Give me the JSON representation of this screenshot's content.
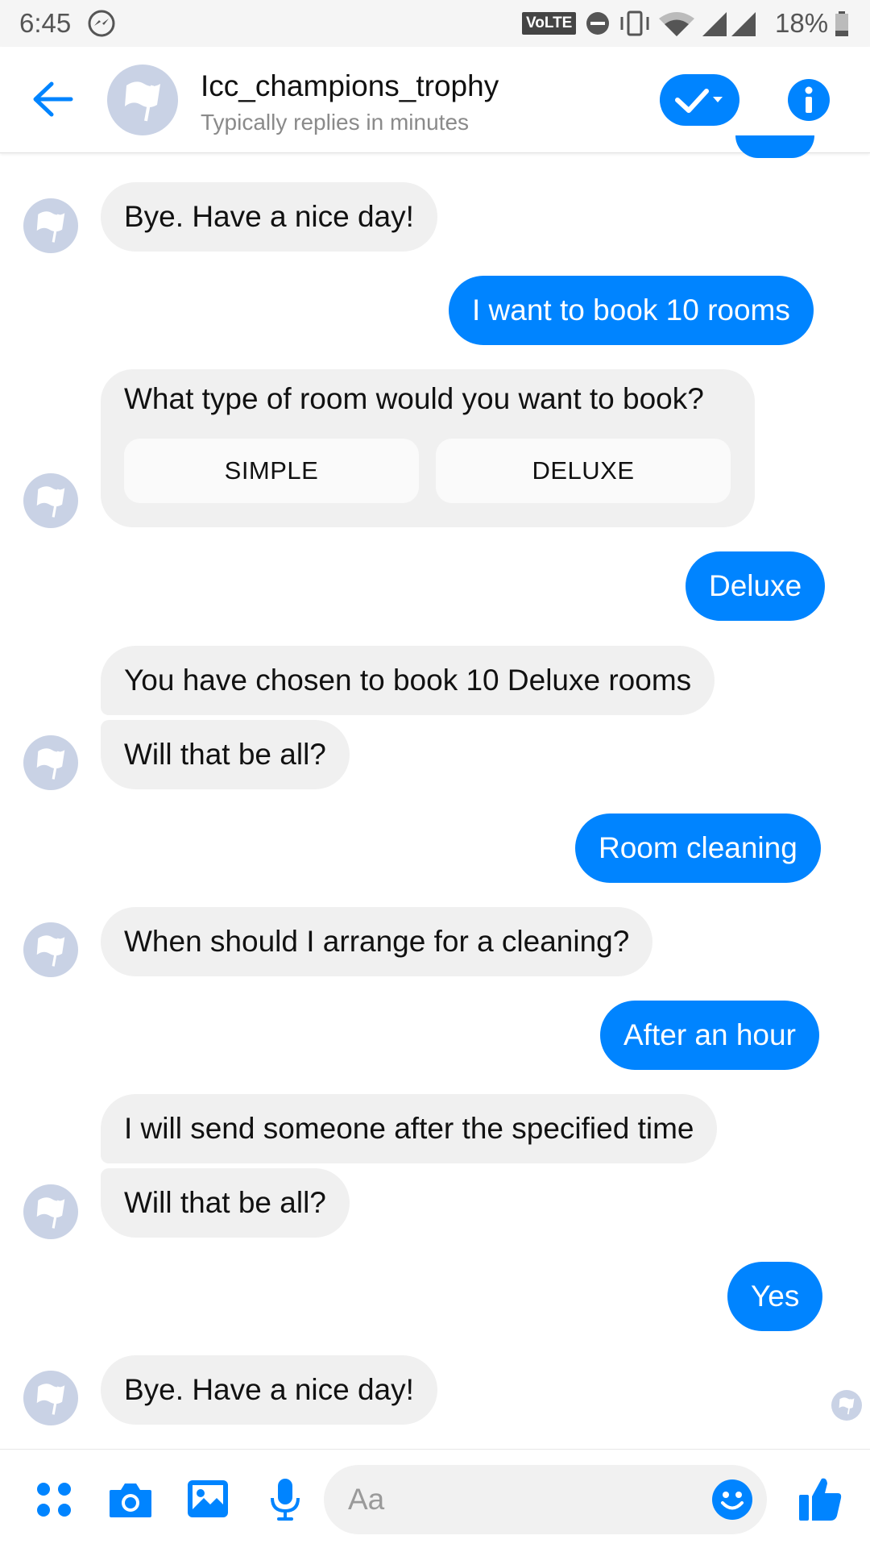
{
  "status_bar": {
    "time": "6:45",
    "network_badge": "VoLTE",
    "battery": "18%"
  },
  "header": {
    "title": "Icc_champions_trophy",
    "subtitle": "Typically replies in minutes"
  },
  "messages": {
    "m1": "Bye. Have a nice day!",
    "m2": "I want to book 10 rooms",
    "m3": "What type of room would you want to book?",
    "m3_option_1": "SIMPLE",
    "m3_option_2": "DELUXE",
    "m4": "Deluxe",
    "m5": "You have chosen to book 10 Deluxe rooms",
    "m6": "Will that be all?",
    "m7": "Room cleaning",
    "m8": "When should I arrange for a cleaning?",
    "m9": "After an hour",
    "m10": "I will send someone after the specified time",
    "m11": "Will that be all?",
    "m12": "Yes",
    "m13": "Bye. Have a nice day!"
  },
  "composer": {
    "placeholder": "Aa"
  },
  "colors": {
    "accent": "#0084ff",
    "incoming_bubble": "#f0f0f0",
    "avatar_bg": "#c9d2e5"
  },
  "icons": {
    "status": [
      "messenger-icon",
      "do-not-disturb-icon",
      "vibrate-icon",
      "wifi-icon",
      "signal-icon",
      "battery-icon"
    ],
    "header": [
      "back-arrow-icon",
      "flag-icon",
      "checkmark-icon",
      "info-icon"
    ],
    "composer": [
      "apps-icon",
      "camera-icon",
      "gallery-icon",
      "microphone-icon",
      "emoji-icon",
      "thumbs-up-icon"
    ]
  }
}
